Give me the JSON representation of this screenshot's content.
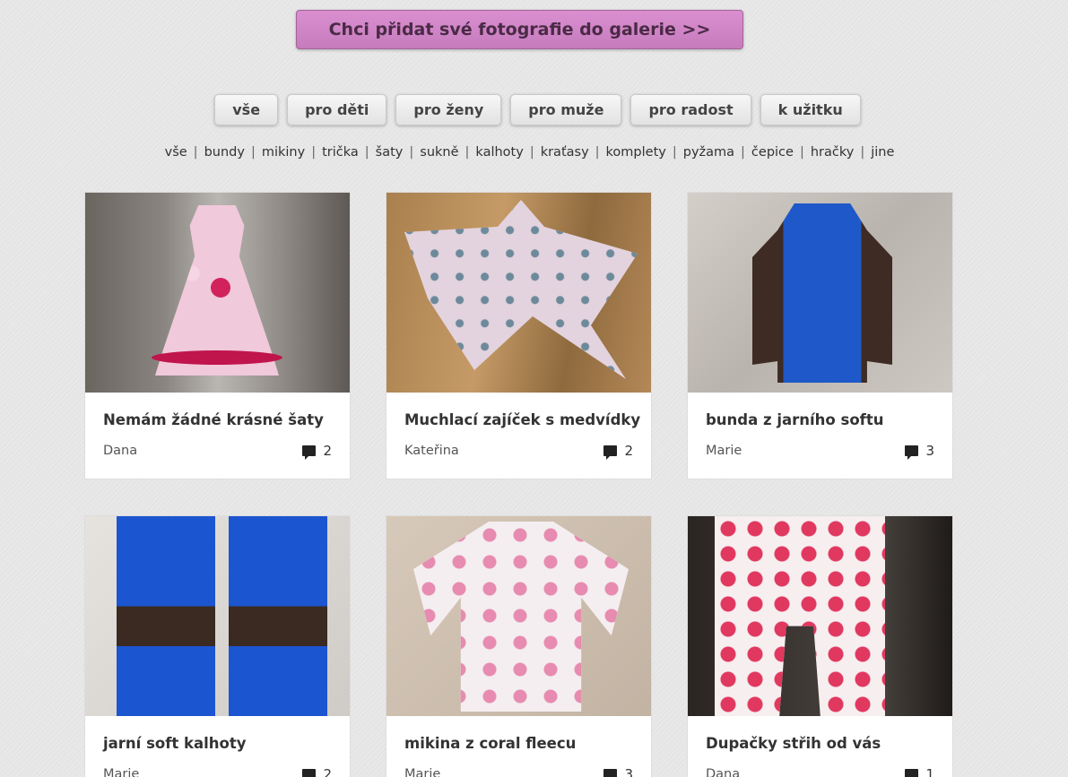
{
  "header": {
    "add_photos_label": "Chci přidat své fotografie do galerie >>"
  },
  "categories": [
    {
      "label": "vše"
    },
    {
      "label": "pro děti"
    },
    {
      "label": "pro ženy"
    },
    {
      "label": "pro muže"
    },
    {
      "label": "pro radost"
    },
    {
      "label": "k užitku"
    }
  ],
  "subcategories": [
    {
      "label": "vše"
    },
    {
      "label": "bundy"
    },
    {
      "label": "mikiny"
    },
    {
      "label": "trička"
    },
    {
      "label": "šaty"
    },
    {
      "label": "sukně"
    },
    {
      "label": "kalhoty"
    },
    {
      "label": "kraťasy"
    },
    {
      "label": "komplety"
    },
    {
      "label": "pyžama"
    },
    {
      "label": "čepice"
    },
    {
      "label": "hračky"
    },
    {
      "label": "jine"
    }
  ],
  "subcategory_separator": "|",
  "gallery": [
    {
      "title": "Nemám žádné krásné šaty",
      "author": "Dana",
      "comments": "2",
      "icon": "comment-icon"
    },
    {
      "title": "Muchlací zajíček s medvídky",
      "author": "Kateřina",
      "comments": "2",
      "icon": "comment-icon"
    },
    {
      "title": "bunda z jarního softu",
      "author": "Marie",
      "comments": "3",
      "icon": "comment-icon"
    },
    {
      "title": "jarní soft kalhoty",
      "author": "Marie",
      "comments": "2",
      "icon": "comment-icon"
    },
    {
      "title": "mikina z coral fleecu",
      "author": "Marie",
      "comments": "3",
      "icon": "comment-icon"
    },
    {
      "title": "Dupačky střih od vás",
      "author": "Dana",
      "comments": "1",
      "icon": "comment-icon"
    }
  ]
}
